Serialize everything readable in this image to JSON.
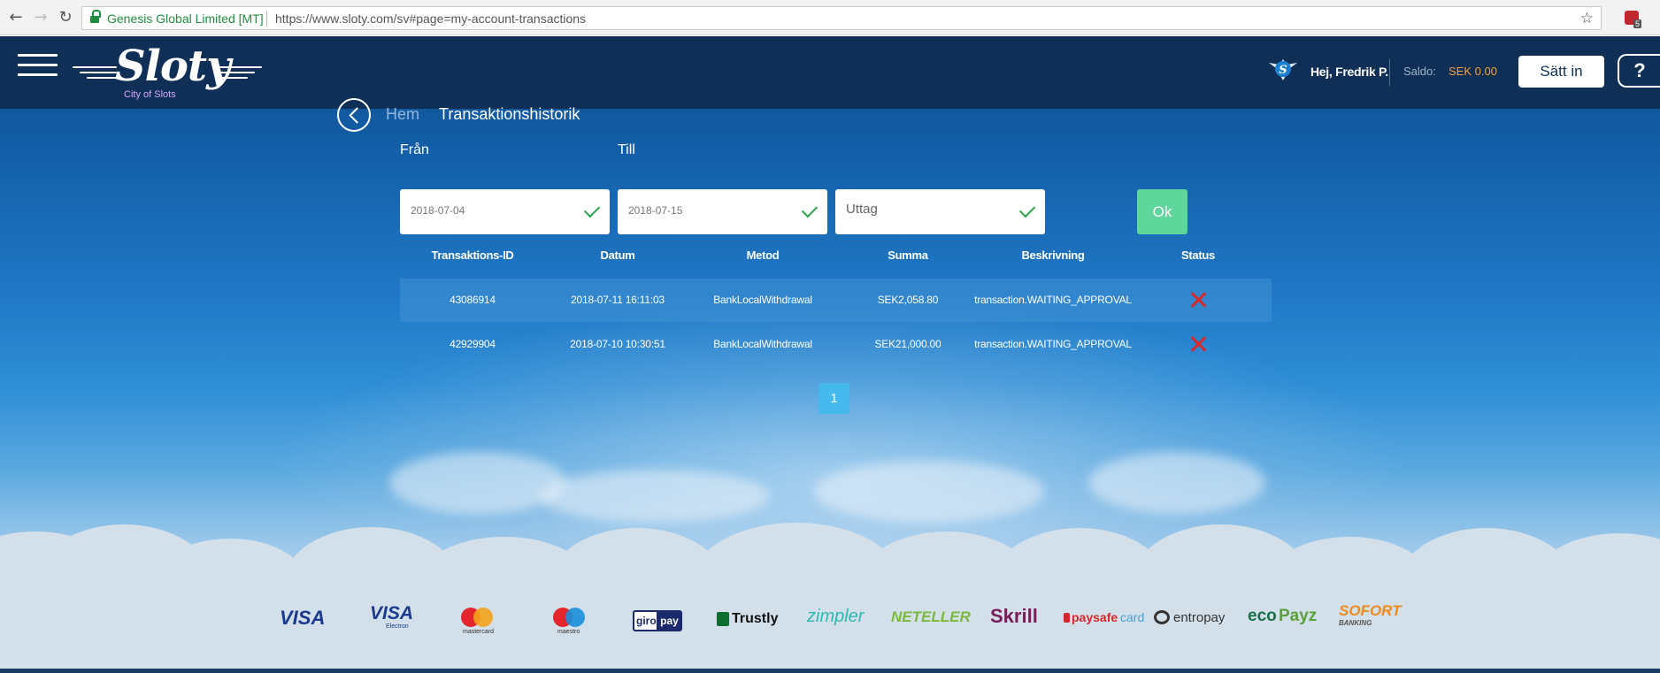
{
  "browser": {
    "cert_label": "Genesis Global Limited [MT]",
    "url": "https://www.sloty.com/sv#page=my-account-transactions",
    "ext_badge": "5"
  },
  "header": {
    "logo_text": "Sloty",
    "logo_subtitle": "City of Slots",
    "greeting": "Hej, Fredrik P.",
    "balance_label": "Saldo:",
    "balance_value": "SEK 0.00",
    "deposit_label": "Sätt in",
    "help_label": "?"
  },
  "breadcrumb": {
    "home": "Hem",
    "current": "Transaktionshistorik"
  },
  "filters": {
    "from_label": "Från",
    "from_value": "2018-07-04",
    "to_label": "Till",
    "to_value": "2018-07-15",
    "type_value": "Uttag",
    "ok_label": "Ok"
  },
  "table": {
    "columns": [
      "Transaktions-ID",
      "Datum",
      "Metod",
      "Summa",
      "Beskrivning",
      "Status"
    ],
    "rows": [
      {
        "id": "43086914",
        "date": "2018-07-11 16:11:03",
        "method": "BankLocalWithdrawal",
        "amount": "SEK2,058.80",
        "description": "transaction.WAITING_APPROVAL",
        "status": "cancel"
      },
      {
        "id": "42929904",
        "date": "2018-07-10 10:30:51",
        "method": "BankLocalWithdrawal",
        "amount": "SEK21,000.00",
        "description": "transaction.WAITING_APPROVAL",
        "status": "cancel"
      }
    ]
  },
  "pagination": {
    "current_page": "1"
  },
  "payment_methods": {
    "visa": "VISA",
    "visa_electron": "VISA",
    "visa_electron_sub": "Electron",
    "mastercard": "mastercard",
    "maestro": "maestro",
    "giropay_a": "giro",
    "giropay_b": "pay",
    "trustly": "Trustly",
    "zimpler": "zimpler",
    "neteller": "NETELLER",
    "skrill": "Skrill",
    "paysafecard_a": "paysafe",
    "paysafecard_b": "card",
    "entropay": "entropay",
    "ecopayz_a": "eco",
    "ecopayz_b": "Payz",
    "sofort": "SOFORT",
    "sofort_sub": "BANKING"
  },
  "colors": {
    "header_bg": "#0f2f57",
    "accent_orange": "#f2a33a",
    "ok_green": "#5fd69b",
    "status_red": "#d62a2a",
    "page_blue": "#45b8ec"
  },
  "icons": [
    "back-arrow-icon",
    "forward-arrow-icon",
    "reload-icon",
    "lock-icon",
    "star-icon",
    "hamburger-icon",
    "chevron-left-icon",
    "check-icon",
    "close-x-icon",
    "help-icon"
  ]
}
